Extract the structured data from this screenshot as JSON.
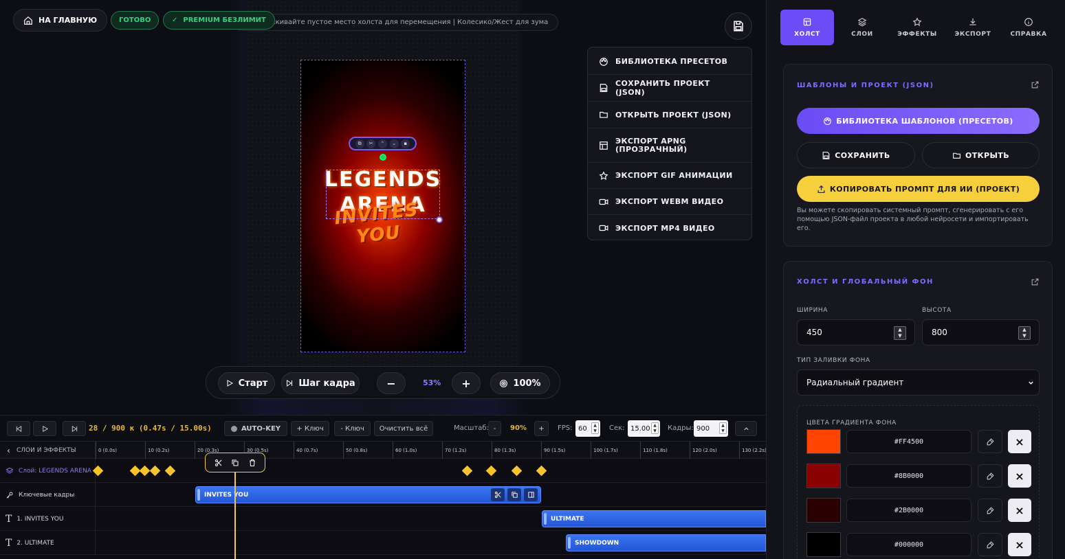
{
  "header": {
    "home_label": "НА ГЛАВНУЮ",
    "status_label": "ГОТОВО",
    "premium_label": "PREMIUM БЕЗЛИМИТ",
    "hint": "аскивайте пустое место холста для перемещения | Колесико/Жест для зума"
  },
  "canvas_preview": {
    "title_line1": "LEGENDS",
    "title_line2": "ARENA",
    "title_line3": "INVITES YOU"
  },
  "menu": {
    "items": [
      {
        "label": "БИБЛИОТЕКА ПРЕСЕТОВ",
        "icon": "palette-icon"
      },
      {
        "label": "СОХРАНИТЬ ПРОЕКТ (JSON)",
        "icon": "save-icon"
      },
      {
        "label": "ОТКРЫТЬ ПРОЕКТ (JSON)",
        "icon": "folder-icon"
      },
      {
        "label": "ЭКСПОРТ APNG (ПРОЗРАЧНЫЙ)",
        "icon": "grid-icon"
      },
      {
        "label": "ЭКСПОРТ GIF АНИМАЦИИ",
        "icon": "star-icon"
      },
      {
        "label": "ЭКСПОРТ WEBM ВИДЕО",
        "icon": "video-icon"
      },
      {
        "label": "ЭКСПОРТ MP4 ВИДЕО",
        "icon": "video-icon"
      }
    ]
  },
  "playback": {
    "start_label": "Старт",
    "step_label": "Шаг кадра",
    "zoom_out": "−",
    "zoom_value": "53%",
    "zoom_in": "+",
    "fit_label": "100%"
  },
  "timeline": {
    "frame_info": "28 / 900 к (0.47s / 15.00s)",
    "autokey_label": "AUTO-KEY",
    "add_key_label": "+ Ключ",
    "remove_key_label": "- Ключ",
    "clear_label": "Очистить всё",
    "scale_label": "Масштаб:",
    "scale_minus": "-",
    "scale_value": "90%",
    "scale_plus": "+",
    "fps_label": "FPS:",
    "fps_value": "60",
    "sec_label": "Сек:",
    "sec_value": "15.00",
    "frames_label": "Кадры:",
    "frames_value": "900",
    "layers_header": "СЛОИ И ЭФФЕКТЫ",
    "ticks": [
      "0 (0.0s)",
      "10 (0.2s)",
      "20 (0.3s)",
      "30 (0.5s)",
      "40 (0.7s)",
      "50 (0.8s)",
      "60 (1.0s)",
      "70 (1.2s)",
      "80 (1.3s)",
      "90 (1.5s)",
      "100 (1.7s)",
      "110 (1.8s)",
      "120 (2.0s)",
      "130 (2.2s)"
    ],
    "rows": [
      {
        "label": "Слой: LEGENDS ARENA"
      },
      {
        "label": "Ключевые кадры",
        "clip": "INVITES YOU"
      },
      {
        "label": "1. INVITES YOU",
        "clip": "ULTIMATE"
      },
      {
        "label": "2. ULTIMATE",
        "clip": "SHOWDOWN"
      }
    ]
  },
  "panel": {
    "tabs": [
      {
        "label": "ХОЛСТ",
        "icon": "canvas-icon",
        "active": true
      },
      {
        "label": "СЛОИ",
        "icon": "layers-icon",
        "active": false
      },
      {
        "label": "ЭФФЕКТЫ",
        "icon": "star-icon",
        "active": false
      },
      {
        "label": "ЭКСПОРТ",
        "icon": "download-icon",
        "active": false
      },
      {
        "label": "СПРАВКА",
        "icon": "info-icon",
        "active": false
      }
    ],
    "templates": {
      "title": "ШАБЛОНЫ И ПРОЕКТ (JSON)",
      "library_label": "БИБЛИОТЕКА ШАБЛОНОВ (ПРЕСЕТОВ)",
      "save_label": "СОХРАНИТЬ",
      "open_label": "ОТКРЫТЬ",
      "copy_prompt_label": "КОПИРОВАТЬ ПРОМПТ ДЛЯ ИИ (ПРОЕКТ)",
      "description": "Вы можете скопировать системный промпт, сгенерировать с его помощью JSON-файл проекта в любой нейросети и импортировать его."
    },
    "canvas": {
      "title": "ХОЛСТ И ГЛОБАЛЬНЫЙ ФОН",
      "width_label": "ШИРИНА",
      "width_value": "450",
      "height_label": "ВЫСОТА",
      "height_value": "800",
      "fill_label": "ТИП ЗАЛИВКИ ФОНА",
      "fill_value": "Радиальный градиент",
      "gradient_label": "ЦВЕТА ГРАДИЕНТА ФОНА",
      "colors": [
        "#FF4500",
        "#8B0000",
        "#2B0000",
        "#000000"
      ]
    }
  },
  "colors": {
    "accent": "#6b4cf6",
    "ready_green": "#34d27f",
    "keyframe_yellow": "#f7c52b",
    "copy_button": "#f5cf3c",
    "clip_blue": "#2f66e6"
  }
}
